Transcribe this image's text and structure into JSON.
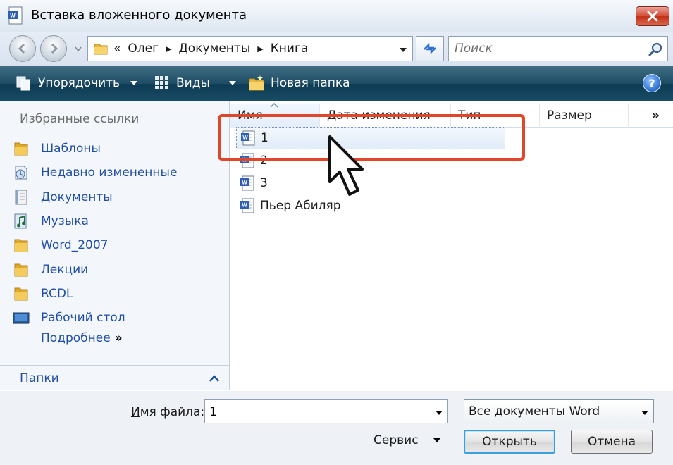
{
  "window": {
    "title": "Вставка вложенного документа"
  },
  "address": {
    "prefix": "«",
    "crumbs": [
      "Олег",
      "Документы",
      "Книга"
    ],
    "search_placeholder": "Поиск"
  },
  "toolbar": {
    "organize_label": "Упорядочить",
    "views_label": "Виды",
    "new_folder_label": "Новая папка",
    "help_label": "?"
  },
  "sidebar": {
    "favorites_heading": "Избранные ссылки",
    "items": [
      {
        "label": "Шаблоны",
        "icon": "folder-icon"
      },
      {
        "label": "Недавно измененные",
        "icon": "recent-icon"
      },
      {
        "label": "Документы",
        "icon": "documents-icon"
      },
      {
        "label": "Музыка",
        "icon": "music-icon"
      },
      {
        "label": "Word_2007",
        "icon": "folder-icon"
      },
      {
        "label": "Лекции",
        "icon": "folder-icon"
      },
      {
        "label": "RCDL",
        "icon": "folder-icon"
      },
      {
        "label": "Рабочий стол",
        "icon": "desktop-icon"
      }
    ],
    "more_label": "Подробнее",
    "more_chevron": "»",
    "folders_label": "Папки"
  },
  "file_list": {
    "columns": [
      "Имя",
      "Дата изменения",
      "Тип",
      "Размер"
    ],
    "more_columns": "»",
    "files": [
      {
        "name": "1",
        "selected": true
      },
      {
        "name": "2",
        "selected": false
      },
      {
        "name": "3",
        "selected": false
      },
      {
        "name": "Пьер Абиляр",
        "selected": false
      }
    ]
  },
  "bottom": {
    "filename_label_underlined": "И",
    "filename_label_rest": "мя файла:",
    "filename_value": "1",
    "filetype_value": "Все документы Word",
    "service_label": "Сервис",
    "open_label": "Открыть",
    "cancel_label": "Отмена"
  },
  "colors": {
    "toolbar": "#1c4b63",
    "link": "#1f4ea8",
    "highlight": "#e0462a",
    "close": "#c13016"
  }
}
